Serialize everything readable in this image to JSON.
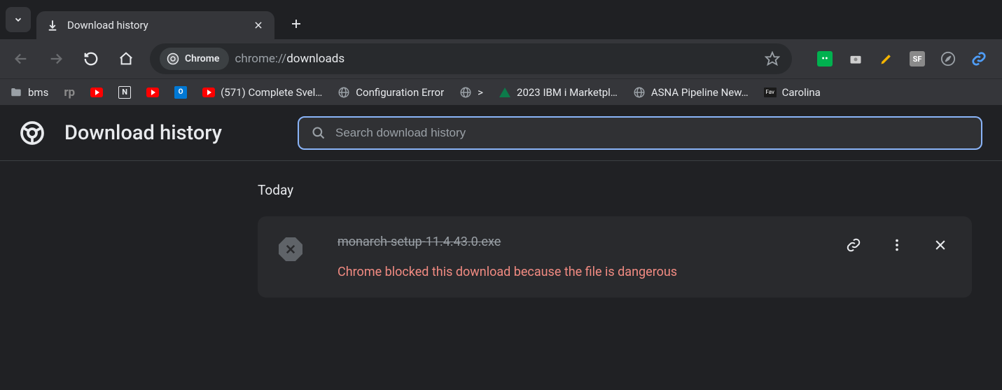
{
  "tab": {
    "title": "Download history"
  },
  "toolbar": {
    "chip_label": "Chrome",
    "url_prefix": "chrome://",
    "url_bold": "downloads"
  },
  "bookmarks": [
    {
      "label": "bms",
      "icon": "folder"
    },
    {
      "label": "rp",
      "icon": "rp"
    },
    {
      "label": "",
      "icon": "yt"
    },
    {
      "label": "",
      "icon": "notion"
    },
    {
      "label": "",
      "icon": "yt"
    },
    {
      "label": "",
      "icon": "outlook"
    },
    {
      "label": "",
      "icon": "yt"
    },
    {
      "label": "(571) Complete Svel…",
      "icon": ""
    },
    {
      "label": "Configuration Error",
      "icon": "globe"
    },
    {
      "label": ">",
      "icon": "globe"
    },
    {
      "label": "2023 IBM i Marketpl…",
      "icon": "asna"
    },
    {
      "label": "ASNA Pipeline New…",
      "icon": "globe"
    },
    {
      "label": "Carolina",
      "icon": "fav"
    }
  ],
  "page": {
    "title": "Download history",
    "search_placeholder": "Search download history",
    "date_header": "Today"
  },
  "download": {
    "filename": "monarch-setup-11.4.43.0.exe",
    "warning": "Chrome blocked this download because the file is dangerous"
  }
}
